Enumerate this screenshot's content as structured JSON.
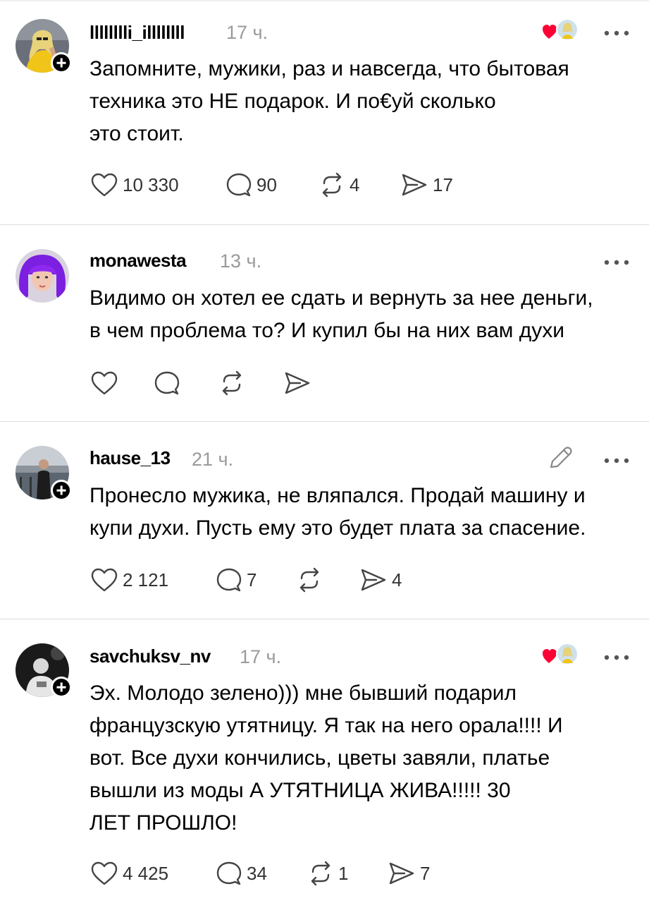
{
  "posts": [
    {
      "username": "lllllllli_illllllll",
      "time": "17 ч.",
      "lines": [
        "Запомните, мужики, раз и навсегда, что бытовая",
        "техника это НЕ подарок. И по€уй сколько",
        "это стоит."
      ],
      "likes": "10 330",
      "replies": "90",
      "reposts": "4",
      "shares": "17",
      "has_author_like": true
    },
    {
      "username": "monawesta",
      "time": "13 ч.",
      "lines": [
        "Видимо он хотел ее сдать и вернуть за нее деньги,",
        "в чем проблема то? И купил бы на них вам духи"
      ],
      "likes": "",
      "replies": "",
      "reposts": "",
      "shares": ""
    },
    {
      "username": "hause_13",
      "time": "21 ч.",
      "lines": [
        "Пронесло мужика, не вляпался. Продай машину и",
        "купи духи. Пусть ему это будет плата за спасение."
      ],
      "likes": "2 121",
      "replies": "7",
      "reposts": "",
      "shares": "4",
      "has_edit": true
    },
    {
      "username": "savchuksv_nv",
      "time": "17 ч.",
      "lines": [
        "Эх. Молодо зелено))) мне бывший подарил",
        "французскую утятницу. Я так на него орала!!!! И",
        "вот. Все духи кончились, цветы завяли, платье",
        "вышли из моды А УТЯТНИЦА ЖИВА!!!!! 30",
        "ЛЕТ ПРОШЛО!"
      ],
      "likes": "4 425",
      "replies": "34",
      "reposts": "1",
      "shares": "7",
      "has_author_like": true
    }
  ],
  "colors": {
    "heart_red": "#ff0034",
    "text": "#000000",
    "muted": "#9a9a9a",
    "divider": "#dbdbdb"
  },
  "icons": [
    "heart-icon",
    "reply-icon",
    "repost-icon",
    "share-icon",
    "more-icon",
    "edit-icon",
    "follow-plus-icon"
  ]
}
